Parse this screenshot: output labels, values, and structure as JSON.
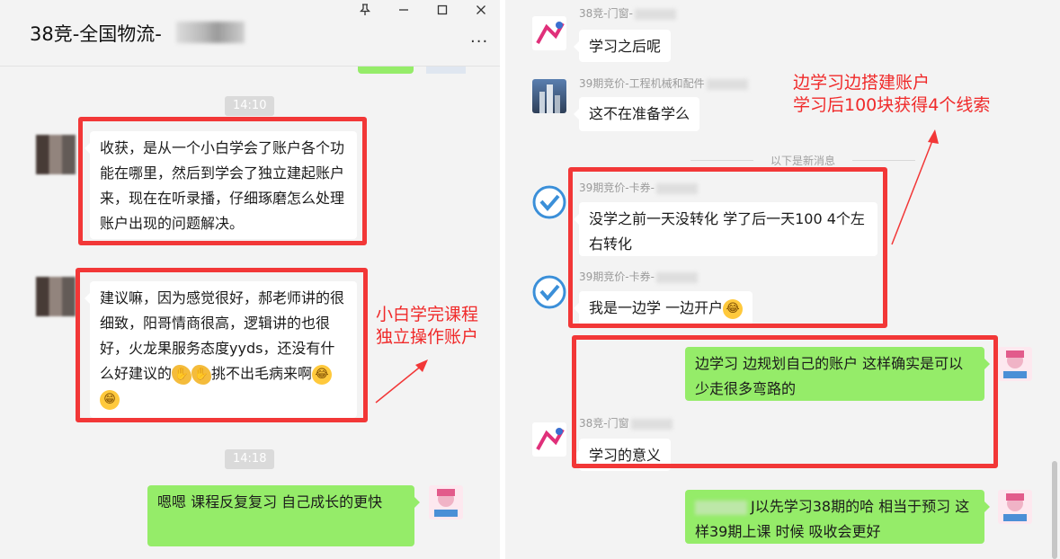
{
  "window": {
    "title": "38竞-全国物流-",
    "controls": [
      "pin-icon",
      "minimize-icon",
      "maximize-icon",
      "close-icon"
    ],
    "more_label": "···"
  },
  "left_chat": {
    "timestamps": [
      "14:10",
      "14:18"
    ],
    "messages": [
      {
        "side": "left",
        "text": "收获，是从一个小白学会了账户各个功能在哪里，然后到学会了独立建起账户来，现在在听录播，仔细琢磨怎么处理账户出现的问题解决。"
      },
      {
        "side": "left",
        "text_before_emoji": "建议嘛，因为感觉很好，郝老师讲的很细致，阳哥情商很高，逻辑讲的也很好，火龙果服务态度yyds，还没有什么好建议的",
        "text_after_emoji": "挑不出毛病来啊"
      },
      {
        "side": "right",
        "text": "嗯嗯 课程反复复习  自己成长的更快"
      }
    ],
    "annotation": [
      "小白学完课程",
      "独立操作账户"
    ]
  },
  "right_chat": {
    "messages": [
      {
        "sender": "38竞-门窗-",
        "side": "left",
        "text": "学习之后呢"
      },
      {
        "sender": "39期竞价-工程机械和配件",
        "side": "left",
        "text": "这不在准备学么"
      },
      {
        "sender": "39期竞价-卡券-",
        "side": "left",
        "text": "没学之前一天没转化 学了后一天100 4个左右转化"
      },
      {
        "sender": "39期竞价-卡券-",
        "side": "left",
        "text": "我是一边学 一边开户"
      },
      {
        "side": "right",
        "text": "边学习  边规划自己的账户  这样确实是可以少走很多弯路的"
      },
      {
        "sender": "38竞-门窗",
        "side": "left",
        "text": "学习的意义"
      },
      {
        "side": "right",
        "text": "J以先学习38期的哈  相当于预习   这样39期上课 时候    吸收会更好"
      }
    ],
    "new_messages_label": "以下是新消息",
    "annotation": [
      "边学习边搭建账户",
      "学习后100块获得4个线索"
    ]
  },
  "colors": {
    "bubble_green": "#95ec69",
    "highlight_red": "#f23737",
    "background": "#f3f3f3"
  }
}
